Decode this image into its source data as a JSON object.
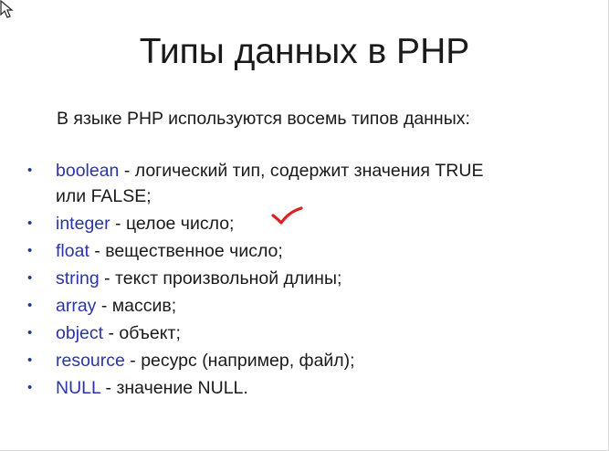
{
  "slide": {
    "title": "Типы данных в PHP",
    "intro": "В языке PHP используются восемь типов данных:",
    "items": [
      {
        "keyword": "boolean",
        "desc": " - логический тип, содержит значения TRUE",
        "desc2": "или FALSE;"
      },
      {
        "keyword": "integer",
        "desc": " - целое число;"
      },
      {
        "keyword": "float",
        "desc": " - вещественное число;"
      },
      {
        "keyword": "string",
        "desc": " - текст произвольной длины;"
      },
      {
        "keyword": "array",
        "desc": " - массив;"
      },
      {
        "keyword": "object",
        "desc": " - объект;"
      },
      {
        "keyword": "resource",
        "desc": " - ресурс (например, файл);"
      },
      {
        "keyword": "NULL",
        "desc": " - значение NULL."
      }
    ],
    "bullet": "•"
  },
  "colors": {
    "keyword": "#2a35a8",
    "bullet": "#1f3a93",
    "checkmark": "#e02020",
    "text": "#1a1a1a"
  },
  "icons": {
    "cursor": "mouse-pointer-icon",
    "check": "checkmark-icon"
  }
}
